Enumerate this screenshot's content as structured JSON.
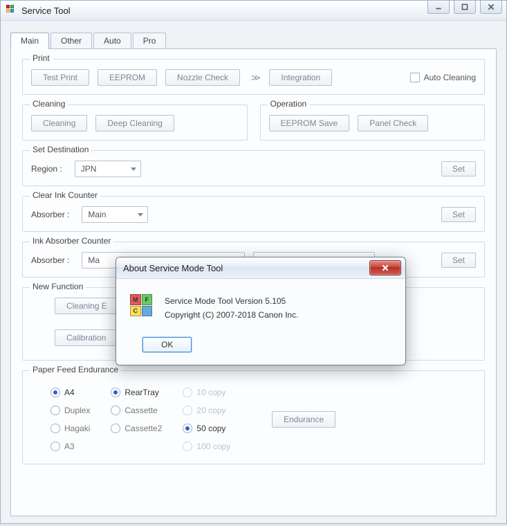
{
  "window": {
    "title": "Service Tool"
  },
  "tabs": [
    "Main",
    "Other",
    "Auto",
    "Pro"
  ],
  "print": {
    "legend": "Print",
    "test": "Test Print",
    "eeprom": "EEPROM",
    "nozzle": "Nozzle Check",
    "integration": "Integration",
    "auto_cleaning": "Auto Cleaning"
  },
  "cleaning": {
    "legend": "Cleaning",
    "cleaning": "Cleaning",
    "deep": "Deep Cleaning"
  },
  "operation": {
    "legend": "Operation",
    "save": "EEPROM Save",
    "panel": "Panel Check"
  },
  "dest": {
    "legend": "Set Destination",
    "label": "Region :",
    "value": "JPN",
    "set": "Set"
  },
  "clearink": {
    "legend": "Clear Ink Counter",
    "label": "Absorber :",
    "value": "Main",
    "set": "Set"
  },
  "inkabs": {
    "legend": "Ink Absorber Counter",
    "label": "Absorber :",
    "value": "Ma",
    "set": "Set"
  },
  "newfunc": {
    "legend": "New Function",
    "btn1": "Cleaning E",
    "btn2": "Calibration"
  },
  "feed": {
    "legend": "Paper Feed Endurance",
    "col1": [
      "A4",
      "Duplex",
      "Hagaki",
      "A3"
    ],
    "col2": [
      "RearTray",
      "Cassette",
      "Cassette2"
    ],
    "col3": [
      "10 copy",
      "20 copy",
      "50 copy",
      "100 copy"
    ],
    "endurance": "Endurance"
  },
  "modal": {
    "title": "About Service Mode Tool",
    "line1": "Service Mode Tool  Version 5.105",
    "line2": "Copyright (C) 2007-2018 Canon Inc.",
    "ok": "OK"
  }
}
